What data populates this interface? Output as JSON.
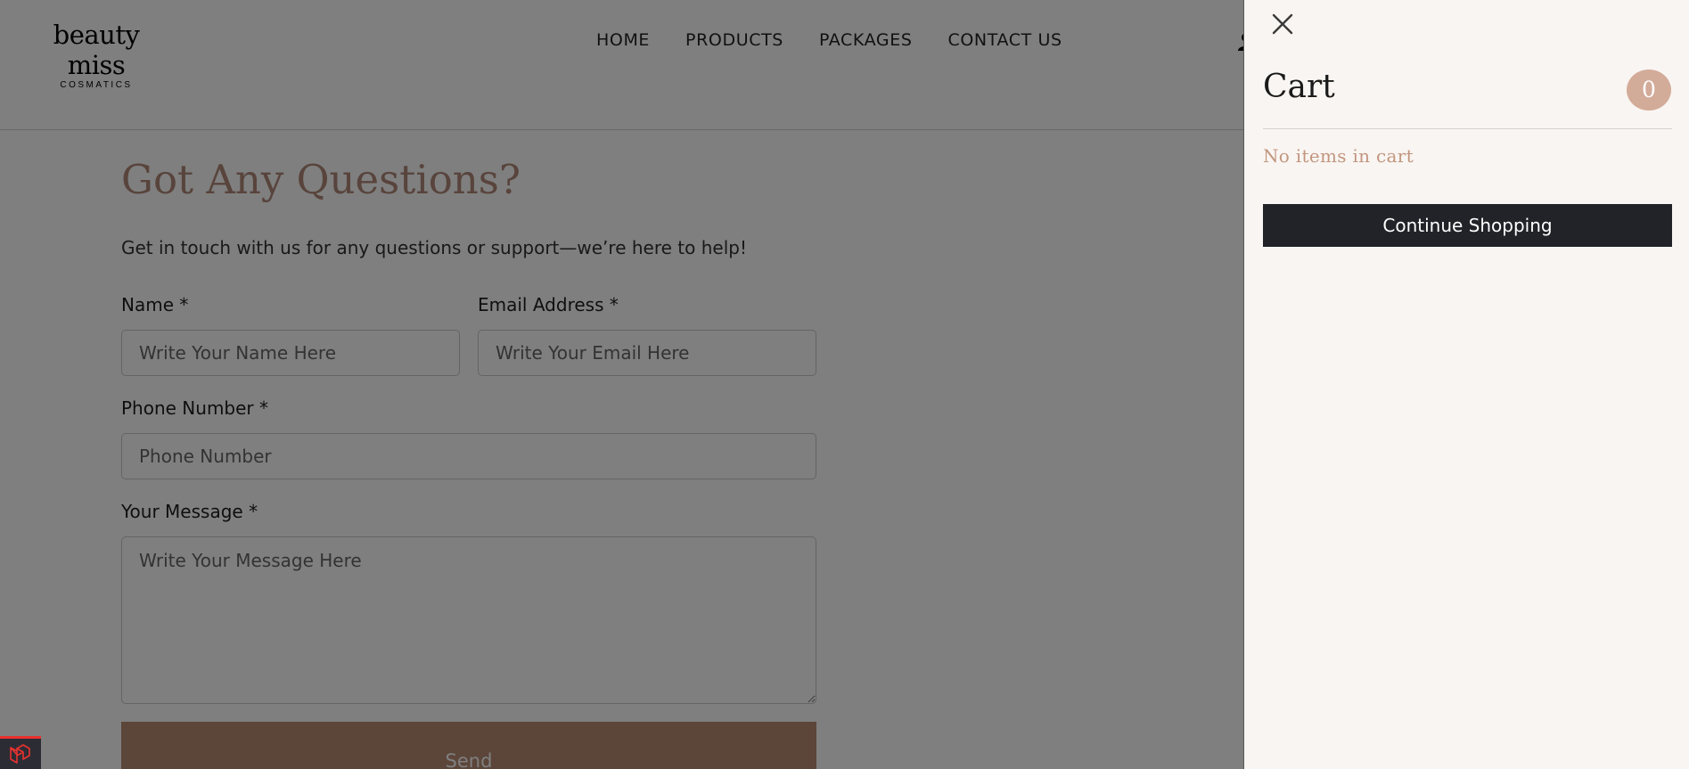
{
  "header": {
    "logo": {
      "name": "beauty miss",
      "tagline": "COSMATICS"
    },
    "nav": [
      {
        "label": "HOME"
      },
      {
        "label": "PRODUCTS"
      },
      {
        "label": "PACKAGES"
      },
      {
        "label": "CONTACT US"
      }
    ],
    "icons": {
      "account": "user-icon"
    }
  },
  "contact": {
    "title": "Got Any Questions?",
    "intro": "Get in touch with us for any questions or support—we’re here to help!",
    "name": {
      "label": "Name *",
      "placeholder": "Write Your Name Here"
    },
    "email": {
      "label": "Email Address *",
      "placeholder": "Write Your Email Here"
    },
    "phone": {
      "label": "Phone Number *",
      "placeholder": "Phone Number"
    },
    "message": {
      "label": "Your Message *",
      "placeholder": "Write Your Message Here"
    },
    "send_label": "Send"
  },
  "cart": {
    "title": "Cart",
    "count": "0",
    "empty_message": "No items in cart",
    "continue_label": "Continue Shopping",
    "icons": {
      "close": "close-icon"
    }
  },
  "debug_badge": {
    "icon": "laravel-icon",
    "accent": "#e8322f"
  },
  "colors": {
    "brand_accent": "#b98a72",
    "title_color": "#b08878",
    "cart_badge": "#d3ab99",
    "dark_button": "#212328",
    "drawer_bg": "#f9f5f2",
    "overlay": "rgba(0,0,0,0.5)"
  }
}
